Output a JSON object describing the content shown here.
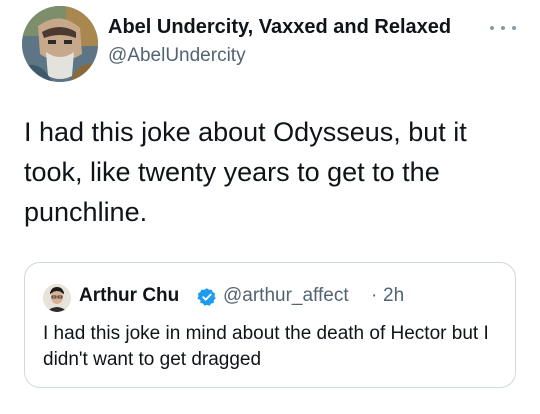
{
  "tweet": {
    "author": {
      "display_name": "Abel Undercity, Vaxxed and Relaxed",
      "handle": "@AbelUndercity",
      "avatar_icon": "painted-portrait-avatar"
    },
    "text": "I had this joke about Odysseus, but it took, like twenty years to get to the punchline.",
    "more_icon": "more-options-icon"
  },
  "quoted_tweet": {
    "author": {
      "display_name": "Arthur Chu",
      "handle": "@arthur_affect",
      "verified": true,
      "avatar_icon": "profile-photo-avatar"
    },
    "separator": "·",
    "time": "2h",
    "text": "I had this joke in mind about the death of Hector but I didn't want to get dragged"
  },
  "colors": {
    "primary_text": "#0f1419",
    "secondary_text": "#536471",
    "border": "#cfd9de",
    "verified_blue": "#1d9bf0"
  }
}
